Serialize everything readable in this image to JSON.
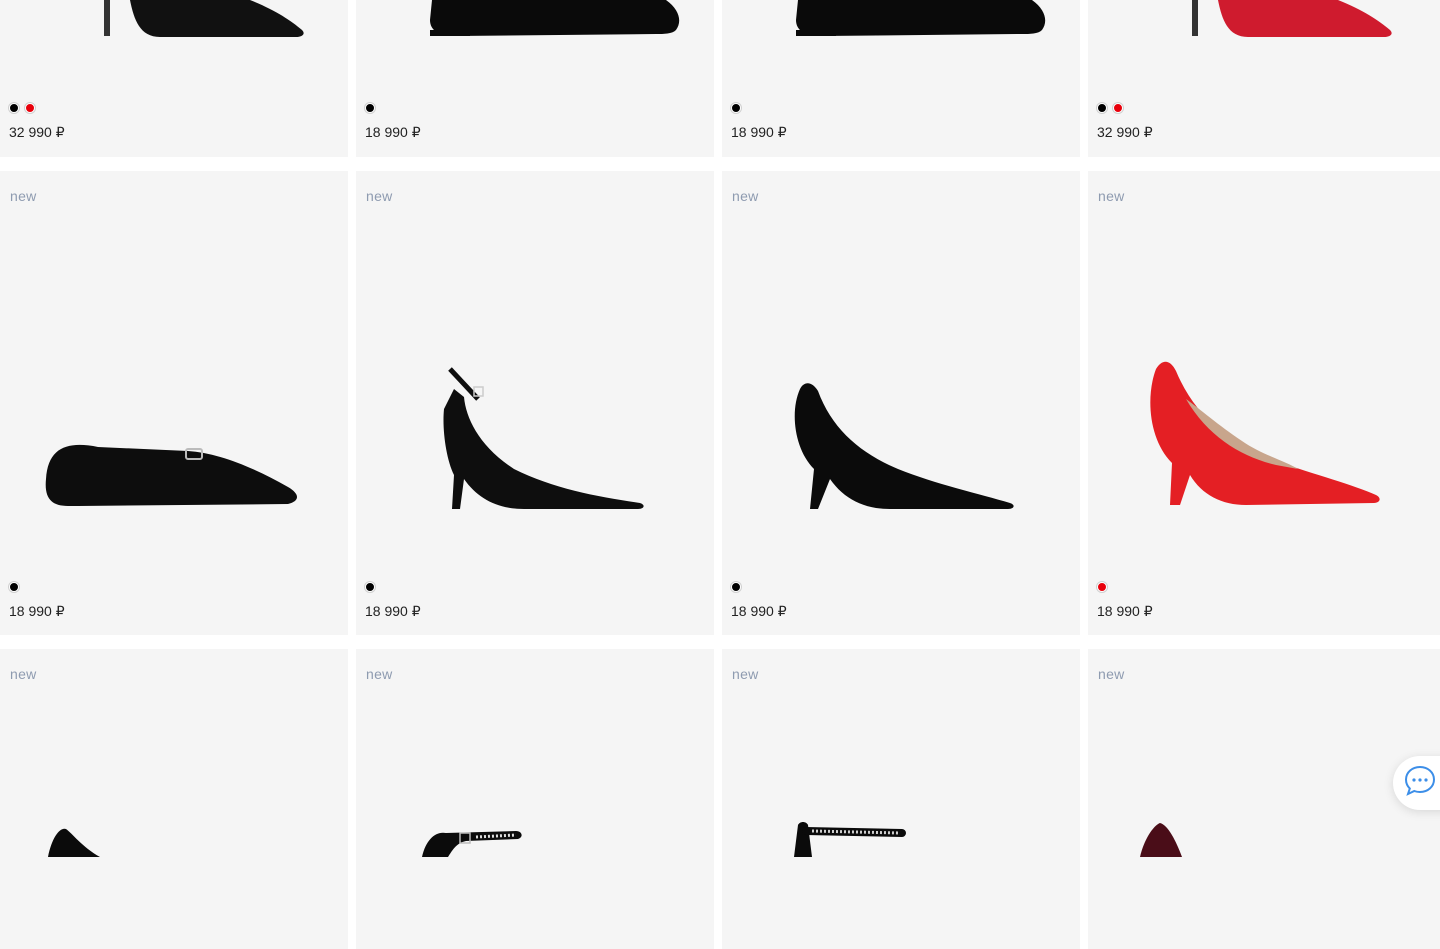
{
  "products": [
    {
      "row": 0,
      "col": 0,
      "badge": "",
      "price": "32 990 ₽",
      "swatches": [
        "#000000",
        "#e8000b"
      ],
      "shoe": "pump-top",
      "color": "#111111"
    },
    {
      "row": 0,
      "col": 1,
      "badge": "",
      "price": "18 990 ₽",
      "swatches": [
        "#000000"
      ],
      "shoe": "flat-top",
      "color": "#0a0a0a"
    },
    {
      "row": 0,
      "col": 2,
      "badge": "",
      "price": "18 990 ₽",
      "swatches": [
        "#000000"
      ],
      "shoe": "flat-top",
      "color": "#0a0a0a"
    },
    {
      "row": 0,
      "col": 3,
      "badge": "",
      "price": "32 990 ₽",
      "swatches": [
        "#000000",
        "#e8000b"
      ],
      "shoe": "pump-top",
      "color": "#cf1b2e"
    },
    {
      "row": 1,
      "col": 0,
      "badge": "new",
      "price": "18 990 ₽",
      "swatches": [
        "#000000"
      ],
      "shoe": "flat",
      "color": "#0d0d0d"
    },
    {
      "row": 1,
      "col": 1,
      "badge": "new",
      "price": "18 990 ₽",
      "swatches": [
        "#000000"
      ],
      "shoe": "slingback",
      "color": "#0e0e0e"
    },
    {
      "row": 1,
      "col": 2,
      "badge": "new",
      "price": "18 990 ₽",
      "swatches": [
        "#000000"
      ],
      "shoe": "pump",
      "color": "#0b0b0b"
    },
    {
      "row": 1,
      "col": 3,
      "badge": "new",
      "price": "18 990 ₽",
      "swatches": [
        "#e8000b"
      ],
      "shoe": "pump-red",
      "color": "#e41f24"
    },
    {
      "row": 2,
      "col": 0,
      "badge": "new",
      "price": "",
      "swatches": [],
      "shoe": "partial-pump",
      "color": "#0b0b0b"
    },
    {
      "row": 2,
      "col": 1,
      "badge": "new",
      "price": "",
      "swatches": [],
      "shoe": "partial-strap",
      "color": "#0b0b0b"
    },
    {
      "row": 2,
      "col": 2,
      "badge": "new",
      "price": "",
      "swatches": [],
      "shoe": "partial-ankle",
      "color": "#0b0b0b"
    },
    {
      "row": 2,
      "col": 3,
      "badge": "new",
      "price": "",
      "swatches": [],
      "shoe": "partial-burgundy",
      "color": "#4a0d18"
    }
  ],
  "chat_widget": {
    "icon": "chat-bubble-icon",
    "accent": "#3c8ee8"
  }
}
